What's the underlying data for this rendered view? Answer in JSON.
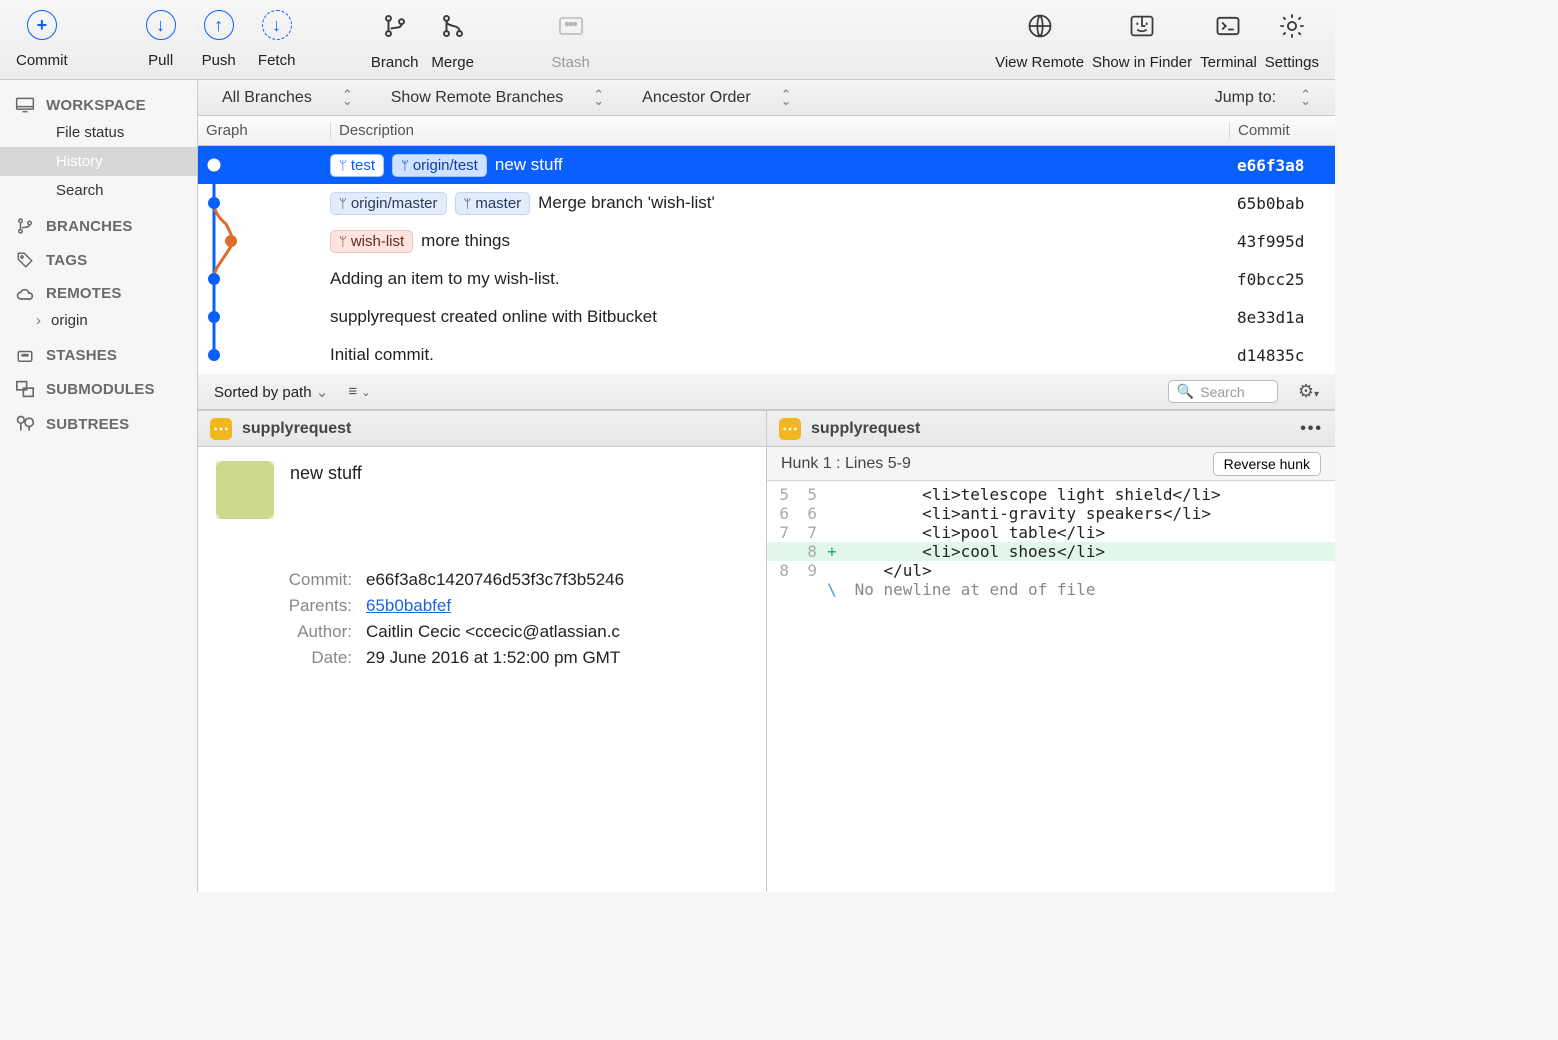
{
  "toolbar": {
    "commit": "Commit",
    "pull": "Pull",
    "push": "Push",
    "fetch": "Fetch",
    "branch": "Branch",
    "merge": "Merge",
    "stash": "Stash",
    "view_remote": "View Remote",
    "show_finder": "Show in Finder",
    "terminal": "Terminal",
    "settings": "Settings"
  },
  "sidebar": {
    "workspace": "WORKSPACE",
    "file_status": "File status",
    "history": "History",
    "search": "Search",
    "branches": "BRANCHES",
    "tags": "TAGS",
    "remotes": "REMOTES",
    "origin": "origin",
    "stashes": "STASHES",
    "submodules": "SUBMODULES",
    "subtrees": "SUBTREES"
  },
  "filters": {
    "all_branches": "All Branches",
    "show_remote": "Show Remote Branches",
    "ancestor": "Ancestor Order",
    "jump": "Jump to:"
  },
  "columns": {
    "graph": "Graph",
    "description": "Description",
    "commit": "Commit"
  },
  "commits": [
    {
      "tags": [
        {
          "t": "test",
          "sel": true
        },
        {
          "t": "origin/test"
        }
      ],
      "msg": "new stuff",
      "sha": "e66f3a8",
      "selected": true
    },
    {
      "tags": [
        {
          "t": "origin/master"
        },
        {
          "t": "master"
        }
      ],
      "msg": "Merge branch 'wish-list'",
      "sha": "65b0bab"
    },
    {
      "tags": [
        {
          "t": "wish-list",
          "red": true
        }
      ],
      "msg": "more things",
      "sha": "43f995d"
    },
    {
      "tags": [],
      "msg": "Adding an item to my wish-list.",
      "sha": "f0bcc25"
    },
    {
      "tags": [],
      "msg": "supplyrequest created online with Bitbucket",
      "sha": "8e33d1a"
    },
    {
      "tags": [],
      "msg": "Initial commit.",
      "sha": "d14835c"
    }
  ],
  "lower": {
    "sorted": "Sorted by path",
    "search_placeholder": "Search",
    "file": "supplyrequest",
    "hunk": "Hunk 1 : Lines 5-9",
    "reverse": "Reverse hunk",
    "diff": [
      {
        "a": "5",
        "b": "5",
        "m": "",
        "c": "        <li>telescope light shield</li>"
      },
      {
        "a": "6",
        "b": "6",
        "m": "",
        "c": "        <li>anti-gravity speakers</li>"
      },
      {
        "a": "7",
        "b": "7",
        "m": "",
        "c": "        <li>pool table</li>"
      },
      {
        "a": "",
        "b": "8",
        "m": "+",
        "c": "        <li>cool shoes</li>",
        "add": true
      },
      {
        "a": "8",
        "b": "9",
        "m": "",
        "c": "    </ul>"
      },
      {
        "a": "",
        "b": "",
        "m": "\\",
        "c": " No newline at end of file",
        "meta": true
      }
    ]
  },
  "details": {
    "title": "new stuff",
    "commit_label": "Commit:",
    "commit": "e66f3a8c1420746d53f3c7f3b5246",
    "parents_label": "Parents:",
    "parents": "65b0babfef",
    "author_label": "Author:",
    "author": "Caitlin Cecic <ccecic@atlassian.c",
    "date_label": "Date:",
    "date": "29 June 2016 at 1:52:00 pm GMT"
  }
}
